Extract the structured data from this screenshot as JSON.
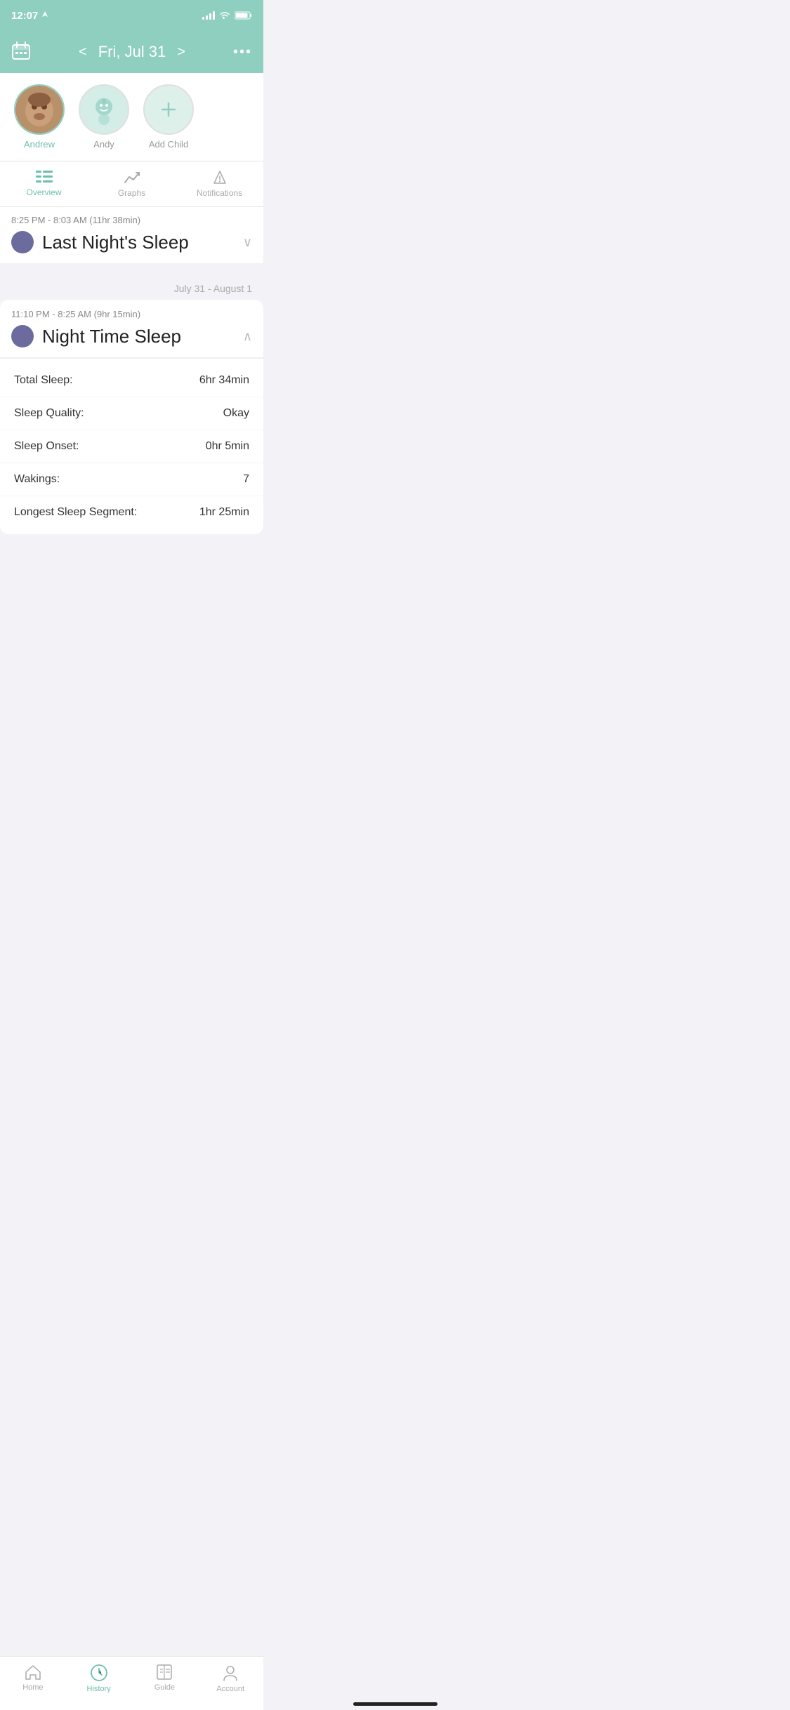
{
  "statusBar": {
    "time": "12:07",
    "locationIcon": "▷"
  },
  "header": {
    "calendarIcon": "📅",
    "prevBtn": "<",
    "nextBtn": ">",
    "title": "Fri, Jul 31",
    "moreBtn": "•••"
  },
  "children": [
    {
      "name": "Andrew",
      "active": true,
      "type": "photo"
    },
    {
      "name": "Andy",
      "active": false,
      "type": "baby"
    },
    {
      "name": "Add Child",
      "active": false,
      "type": "add"
    }
  ],
  "tabs": [
    {
      "label": "Overview",
      "active": true,
      "icon": "≡"
    },
    {
      "label": "Graphs",
      "active": false,
      "icon": "📈"
    },
    {
      "label": "Notifications",
      "active": false,
      "icon": "⚠"
    }
  ],
  "lastNightSleep": {
    "timeRange": "8:25 PM - 8:03 AM",
    "duration": "(11hr 38min)",
    "title": "Last Night's Sleep"
  },
  "dateSeparator": "July 31 - August 1",
  "nightTimeSleep": {
    "timeRange": "11:10 PM - 8:25 AM",
    "duration": "(9hr 15min)",
    "title": "Night Time Sleep",
    "stats": [
      {
        "label": "Total Sleep:",
        "value": "6hr 34min"
      },
      {
        "label": "Sleep Quality:",
        "value": "Okay"
      },
      {
        "label": "Sleep Onset:",
        "value": "0hr 5min"
      },
      {
        "label": "Wakings:",
        "value": "7"
      },
      {
        "label": "Longest Sleep Segment:",
        "value": "1hr 25min"
      }
    ]
  },
  "bottomNav": [
    {
      "label": "Home",
      "active": false,
      "icon": "home"
    },
    {
      "label": "History",
      "active": true,
      "icon": "clock"
    },
    {
      "label": "Guide",
      "active": false,
      "icon": "book"
    },
    {
      "label": "Account",
      "active": false,
      "icon": "person"
    }
  ]
}
